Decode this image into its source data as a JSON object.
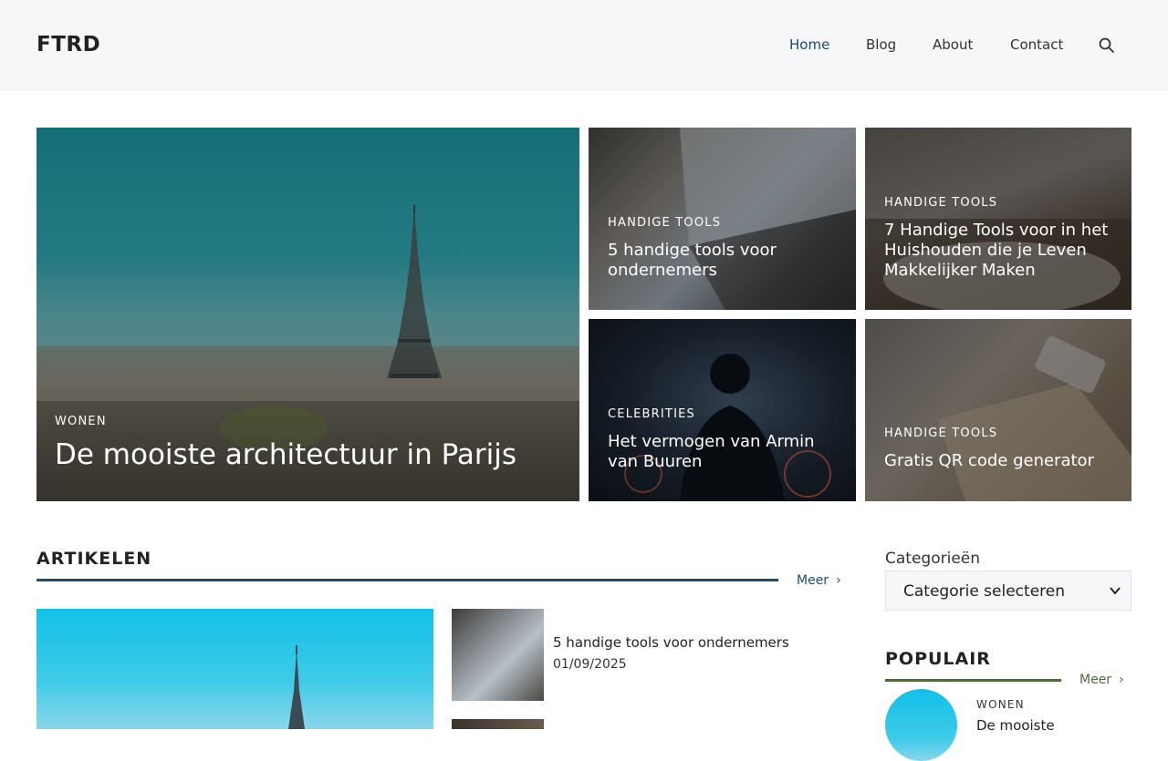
{
  "colors": {
    "header_bg": "#f6f7f9",
    "accent_blue": "#1e4b6e",
    "accent_green": "#4b6b3a"
  },
  "header": {
    "logo": "FTRD",
    "nav": [
      {
        "label": "Home",
        "active": true
      },
      {
        "label": "Blog",
        "active": false
      },
      {
        "label": "About",
        "active": false
      },
      {
        "label": "Contact",
        "active": false
      }
    ],
    "search_icon": "search-icon"
  },
  "featured": {
    "main": {
      "category": "WONEN",
      "title": "De mooiste architectuur in Parijs"
    },
    "items": [
      {
        "category": "HANDIGE TOOLS",
        "title": "5 handige tools voor ondernemers"
      },
      {
        "category": "HANDIGE TOOLS",
        "title": "7 Handige Tools voor in het Huishouden die je Leven Makkelijker Maken"
      },
      {
        "category": "CELEBRITIES",
        "title": "Het vermogen van Armin van Buuren"
      },
      {
        "category": "HANDIGE TOOLS",
        "title": "Gratis QR code generator"
      }
    ]
  },
  "articles": {
    "heading": "ARTIKELEN",
    "more": "Meer",
    "list": [
      {
        "title": "5 handige tools voor ondernemers",
        "date": "01/09/2025"
      }
    ]
  },
  "sidebar": {
    "categories_label": "Categorieën",
    "categories_select": "Categorie selecteren",
    "popular_heading": "POPULAIR",
    "popular_more": "Meer",
    "popular_items": [
      {
        "category": "WONEN",
        "title": "De mooiste"
      }
    ]
  }
}
